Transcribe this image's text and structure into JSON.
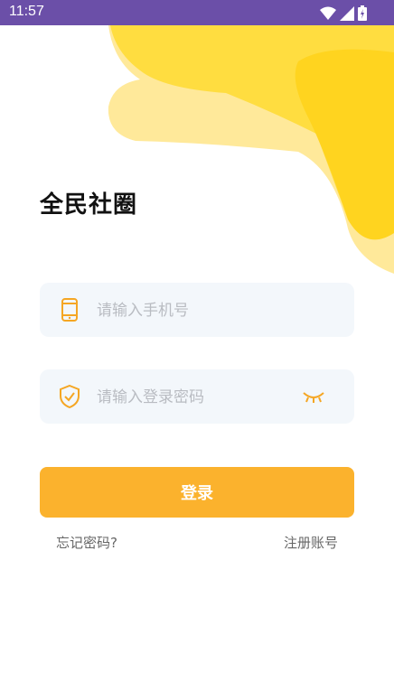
{
  "status_bar": {
    "time": "11:57"
  },
  "app": {
    "title": "全民社圈"
  },
  "form": {
    "phone_placeholder": "请输入手机号",
    "password_placeholder": "请输入登录密码",
    "login_label": "登录"
  },
  "links": {
    "forgot": "忘记密码?",
    "register": "注册账号"
  },
  "colors": {
    "accent": "#fbb22d",
    "status_bar": "#6b4fa8",
    "decor_yellow": "#ffd83a"
  },
  "icons": [
    "wifi-icon",
    "signal-icon",
    "battery-icon",
    "phone-icon",
    "shield-check-icon",
    "eye-closed-icon"
  ]
}
